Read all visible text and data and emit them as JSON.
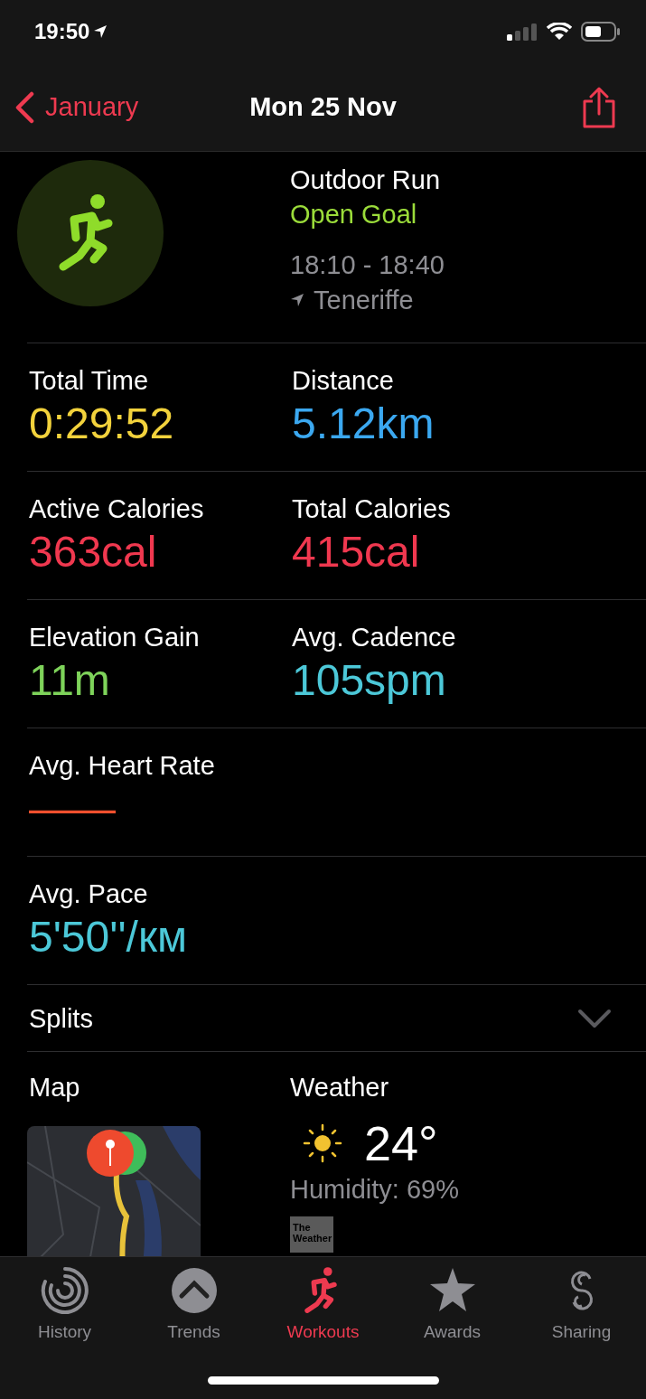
{
  "status_bar": {
    "time": "19:50"
  },
  "nav": {
    "back": "January",
    "title": "Mon 25 Nov"
  },
  "workout": {
    "name": "Outdoor Run",
    "goal": "Open Goal",
    "time_range": "18:10 - 18:40",
    "location": "Teneriffe"
  },
  "metric_rows": [
    [
      {
        "label": "Total Time",
        "value": "0:29:52",
        "color": "#f2d23c"
      },
      {
        "label": "Distance",
        "value": "5.12km",
        "color": "#3ba8f0"
      }
    ],
    [
      {
        "label": "Active Calories",
        "value": "363cal",
        "color": "#f0384f"
      },
      {
        "label": "Total Calories",
        "value": "415cal",
        "color": "#f0384f"
      }
    ],
    [
      {
        "label": "Elevation Gain",
        "value": "11m",
        "color": "#7ed35a"
      },
      {
        "label": "Avg. Cadence",
        "value": "105spm",
        "color": "#4cc8d8"
      }
    ],
    [
      {
        "label": "Avg. Heart Rate",
        "value": "——",
        "color": "#f0502e"
      }
    ],
    [
      {
        "label": "Avg. Pace",
        "value": "5'50''/км",
        "color": "#4cc8d8"
      }
    ]
  ],
  "splits": {
    "label": "Splits",
    "expanded": false
  },
  "map": {
    "label": "Map"
  },
  "weather": {
    "label": "Weather",
    "temperature": "24°",
    "humidity": "Humidity: 69%",
    "source": "The Weather"
  },
  "tabs": [
    {
      "label": "History",
      "kind": "history",
      "selected": false
    },
    {
      "label": "Trends",
      "kind": "trends",
      "selected": false
    },
    {
      "label": "Workouts",
      "kind": "workouts",
      "selected": true
    },
    {
      "label": "Awards",
      "kind": "awards",
      "selected": false
    },
    {
      "label": "Sharing",
      "kind": "sharing",
      "selected": false
    }
  ]
}
